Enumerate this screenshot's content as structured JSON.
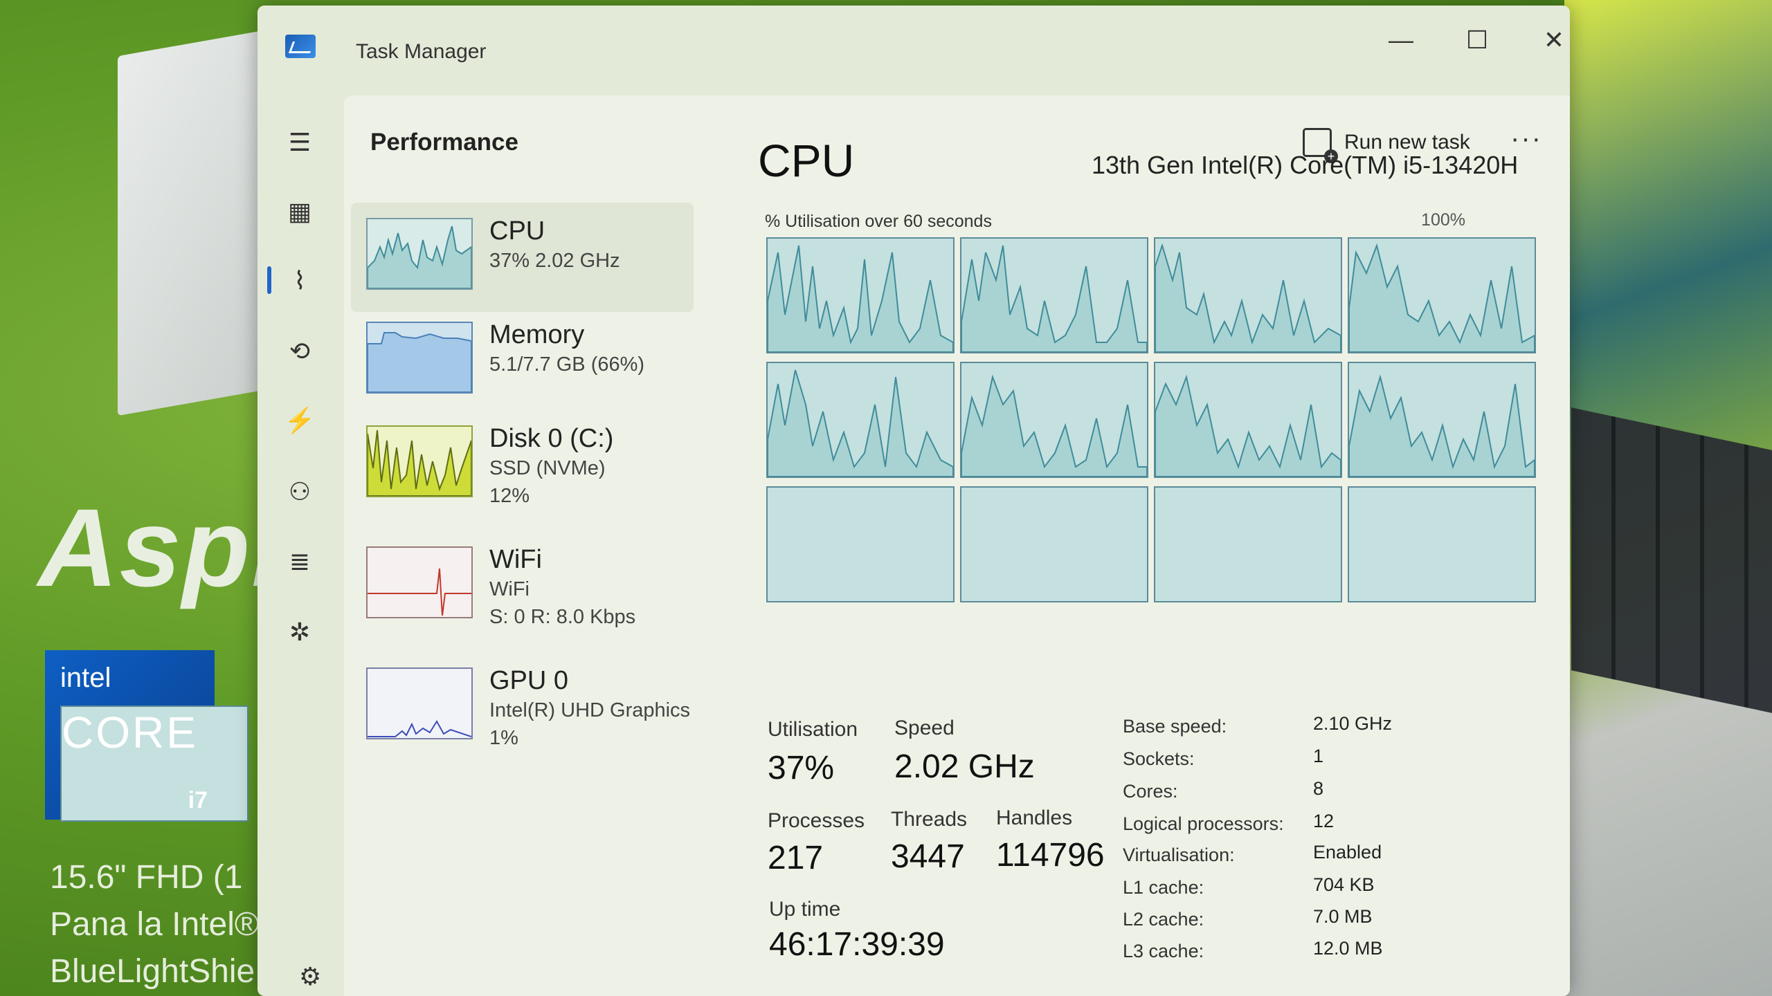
{
  "window": {
    "title": "Task Manager"
  },
  "window_controls": {
    "minimize": "—",
    "maximize": "☐",
    "close": "✕"
  },
  "header": {
    "page_title": "Performance",
    "run_task": "Run new task",
    "more": "···"
  },
  "sidebar": {
    "items": [
      {
        "name": "menu-icon",
        "glyph": "☰"
      },
      {
        "name": "processes-icon",
        "glyph": "▦"
      },
      {
        "name": "performance-icon",
        "glyph": "⌇"
      },
      {
        "name": "app-history-icon",
        "glyph": "⟲"
      },
      {
        "name": "startup-apps-icon",
        "glyph": "⚡"
      },
      {
        "name": "users-icon",
        "glyph": "⚇"
      },
      {
        "name": "details-icon",
        "glyph": "≣"
      },
      {
        "name": "services-icon",
        "glyph": "✲"
      }
    ],
    "settings_glyph": "⚙"
  },
  "resources": [
    {
      "name": "CPU",
      "sub1": "37% 2.02 GHz",
      "sub2": "",
      "selected": true
    },
    {
      "name": "Memory",
      "sub1": "5.1/7.7 GB (66%)",
      "sub2": ""
    },
    {
      "name": "Disk 0 (C:)",
      "sub1": "SSD (NVMe)",
      "sub2": "12%"
    },
    {
      "name": "WiFi",
      "sub1": "WiFi",
      "sub2": "S: 0 R: 8.0 Kbps"
    },
    {
      "name": "GPU 0",
      "sub1": "Intel(R) UHD Graphics",
      "sub2": "1%"
    }
  ],
  "cpu_panel": {
    "title": "CPU",
    "model": "13th Gen Intel(R) Core(TM) i5-13420H",
    "graph_label": "% Utilisation over 60 seconds",
    "graph_max": "100%",
    "stats": {
      "utilisation_label": "Utilisation",
      "utilisation": "37%",
      "speed_label": "Speed",
      "speed": "2.02 GHz",
      "processes_label": "Processes",
      "processes": "217",
      "threads_label": "Threads",
      "threads": "3447",
      "handles_label": "Handles",
      "handles": "114796",
      "uptime_label": "Up time",
      "uptime": "46:17:39:39"
    },
    "specs": [
      {
        "label": "Base speed:",
        "value": "2.10 GHz"
      },
      {
        "label": "Sockets:",
        "value": "1"
      },
      {
        "label": "Cores:",
        "value": "8"
      },
      {
        "label": "Logical processors:",
        "value": "12"
      },
      {
        "label": "Virtualisation:",
        "value": "Enabled"
      },
      {
        "label": "L1 cache:",
        "value": "704 KB"
      },
      {
        "label": "L2 cache:",
        "value": "7.0 MB"
      },
      {
        "label": "L3 cache:",
        "value": "12.0 MB"
      }
    ]
  },
  "background": {
    "brand": "Aspi",
    "intel": "intel",
    "core": "CORE",
    "gen": "i7",
    "ad_lines": [
      "15.6\" FHD (1",
      "Pana la Intel®",
      "BlueLightShie"
    ]
  },
  "colors": {
    "graph_fill": "#c4e0df",
    "graph_line": "#3f8c9a",
    "disk_fill": "#cddc39",
    "wifi_line": "#c0392b",
    "gpu_line": "#3b4db8"
  }
}
